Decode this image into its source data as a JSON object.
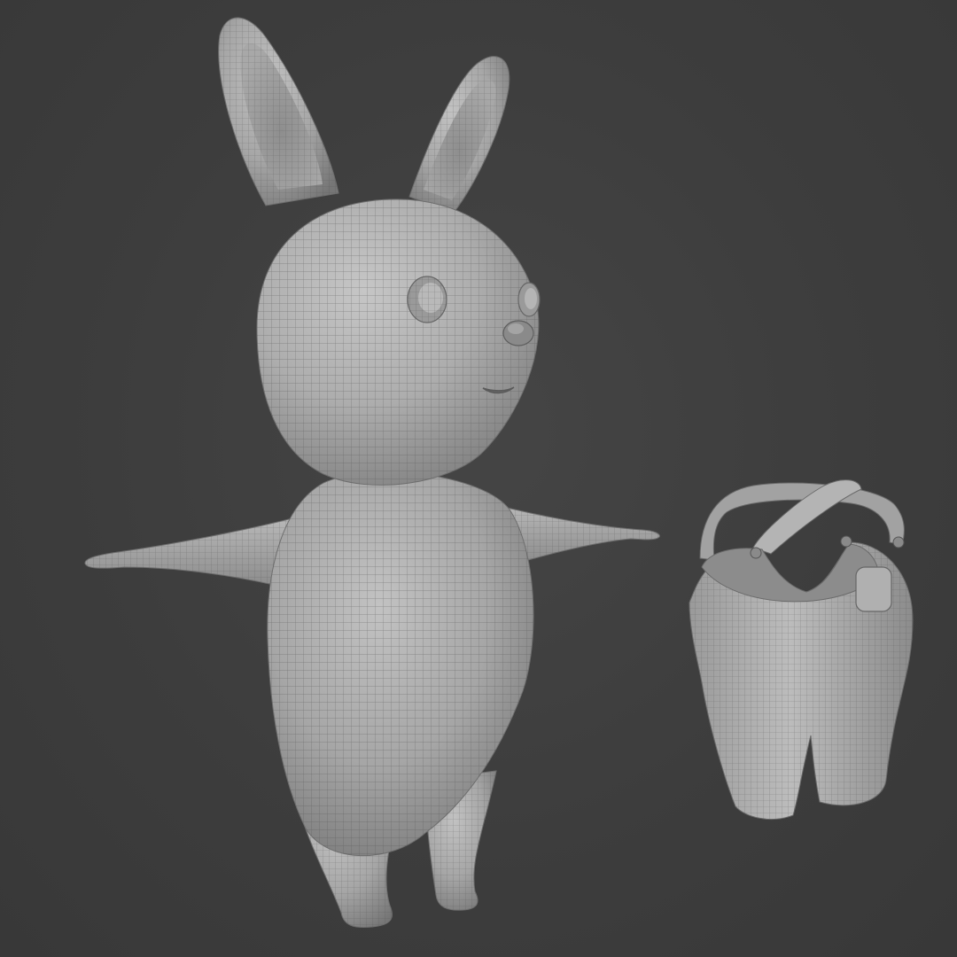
{
  "scene": {
    "background_color": "#3d3d3d",
    "mesh_color": "#a9a9a9",
    "wire_color": "#4a4a4a",
    "objects": [
      "bunny-character-mesh",
      "overalls-mesh"
    ],
    "display_mode": "wireframe-on-shaded"
  }
}
